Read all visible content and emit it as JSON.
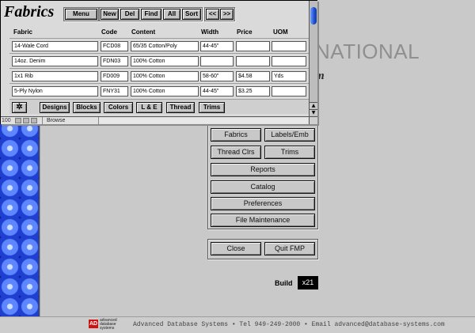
{
  "window": {
    "title": "Fabrics",
    "toolbar": {
      "menu": "Menu",
      "new": "New",
      "del": "Del",
      "find": "Find",
      "all": "All",
      "sort": "Sort",
      "prev": "<<",
      "next": ">>"
    },
    "columns": {
      "fabric": "Fabric",
      "code": "Code",
      "content": "Content",
      "width": "Width",
      "price": "Price",
      "uom": "UOM"
    },
    "rows": [
      {
        "fabric": "14-Wale Cord",
        "code": "FCD08",
        "content": "65/35 Cotton/Poly",
        "width": "44-45\"",
        "price": "",
        "uom": ""
      },
      {
        "fabric": "14oz. Denim",
        "code": "FDN03",
        "content": "100% Cotton",
        "width": "",
        "price": "",
        "uom": ""
      },
      {
        "fabric": "1x1 Rib",
        "code": "FD009",
        "content": "100% Cotton",
        "width": "58-60\"",
        "price": "$4.58",
        "uom": "Yds"
      },
      {
        "fabric": "5-Ply Nylon",
        "code": "FNY31",
        "content": "100% Cotton",
        "width": "44-45\"",
        "price": "$3.25",
        "uom": ""
      }
    ],
    "bottom_buttons": {
      "icon": "snowflake-icon",
      "designs": "Designs",
      "blocks": "Blocks",
      "colors": "Colors",
      "le": "L & E",
      "thread": "Thread",
      "trims": "Trims"
    },
    "status": {
      "zoom": "100",
      "mode": "Browse"
    },
    "scroll_accent": "#2050d0"
  },
  "background": {
    "title_fragment": "NATIONAL",
    "subtitle_fragment": "m",
    "buttons": {
      "fabrics": "Fabrics",
      "labels": "Labels/Emb",
      "thread_clrs": "Thread Clrs",
      "trims": "Trims",
      "reports": "Reports",
      "catalog": "Catalog",
      "preferences": "Preferences",
      "file_maintenance": "File Maintenance",
      "close": "Close",
      "quit": "Quit FMP"
    },
    "build_label": "Build",
    "build_value": "x21",
    "footer": {
      "logo": "AD",
      "logo_text": "advanced database systems",
      "text": "Advanced Database Systems • Tel 949-249-2000 • Email advanced@database-systems.com"
    },
    "side_pattern_color": "#1f3fd0"
  }
}
